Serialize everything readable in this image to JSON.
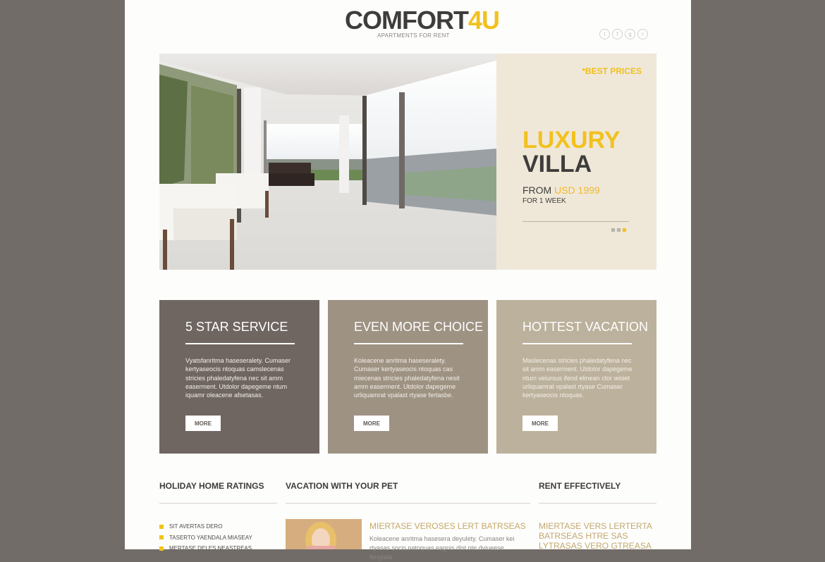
{
  "header": {
    "logo_main": "COMFORT",
    "logo_accent": "4U",
    "tagline": "APARTMENTS FOR RENT",
    "social": [
      {
        "icon": "twitter-icon",
        "glyph": "t"
      },
      {
        "icon": "facebook-icon",
        "glyph": "f"
      },
      {
        "icon": "google-plus-icon",
        "glyph": "g"
      },
      {
        "icon": "rss-icon",
        "glyph": "r"
      }
    ]
  },
  "hero": {
    "badge": "*BEST PRICES",
    "title_line1": "LUXURY",
    "title_line2": "VILLA",
    "from_label": "FROM",
    "price": "USD 1999",
    "period": "FOR 1 WEEK",
    "slides": 3,
    "active_slide": 3
  },
  "features": [
    {
      "title": "5 STAR SERVICE",
      "text": "Vyatsfanritma haseseralety. Cumaser kertyaseocis ntoquas camslecenas stricies phaledatyfena nec sit amm easerment. Utdolor dapegeme ntum iquamr oleacene afsetasas.",
      "button": "MORE"
    },
    {
      "title": "EVEN MORE CHOICE",
      "text": "Koleacene anritma haseseralety. Cumaser kertyaseocis ntoquas cas miecenas stricies phaledatyfena nesit amm easerment. Utdolor dapegeme urliquamrat vpalast rtyase fertasbe.",
      "button": "MORE"
    },
    {
      "title": "HOTTEST VACATION",
      "text": "Maslecenas stricies phaledatyfena nec sit amm easerment. Utdolor dapegeme ntum veiursus ifend elinean ctor wisiet urliquamrat vpalast rtyase Cumaser kertyaseocis ntoquas.",
      "button": "MORE"
    }
  ],
  "bottom": {
    "ratings_title": "HOLIDAY HOME RATINGS",
    "ratings": [
      "SIT AVERTAS DERO",
      "TASERTO YAENDALA MIASEAY",
      "MERTASE DELES NEASTREAS"
    ],
    "pet_title": "VACATION WITH YOUR PET",
    "pet_item_title": "MIERTASE VEROSES LERT BATRSEAS",
    "pet_item_text": "Koleacene anritma hasesera deyulety. Cumaser kei rtyasas socis natoquas eagnis dist nte dviueese feugiata",
    "rent_title": "RENT EFFECTIVELY",
    "rent_item_title": "MIERTASE VERS LERTERTA BATRSEAS HTRE SAS LYTRASAS VERO GTREASA"
  }
}
